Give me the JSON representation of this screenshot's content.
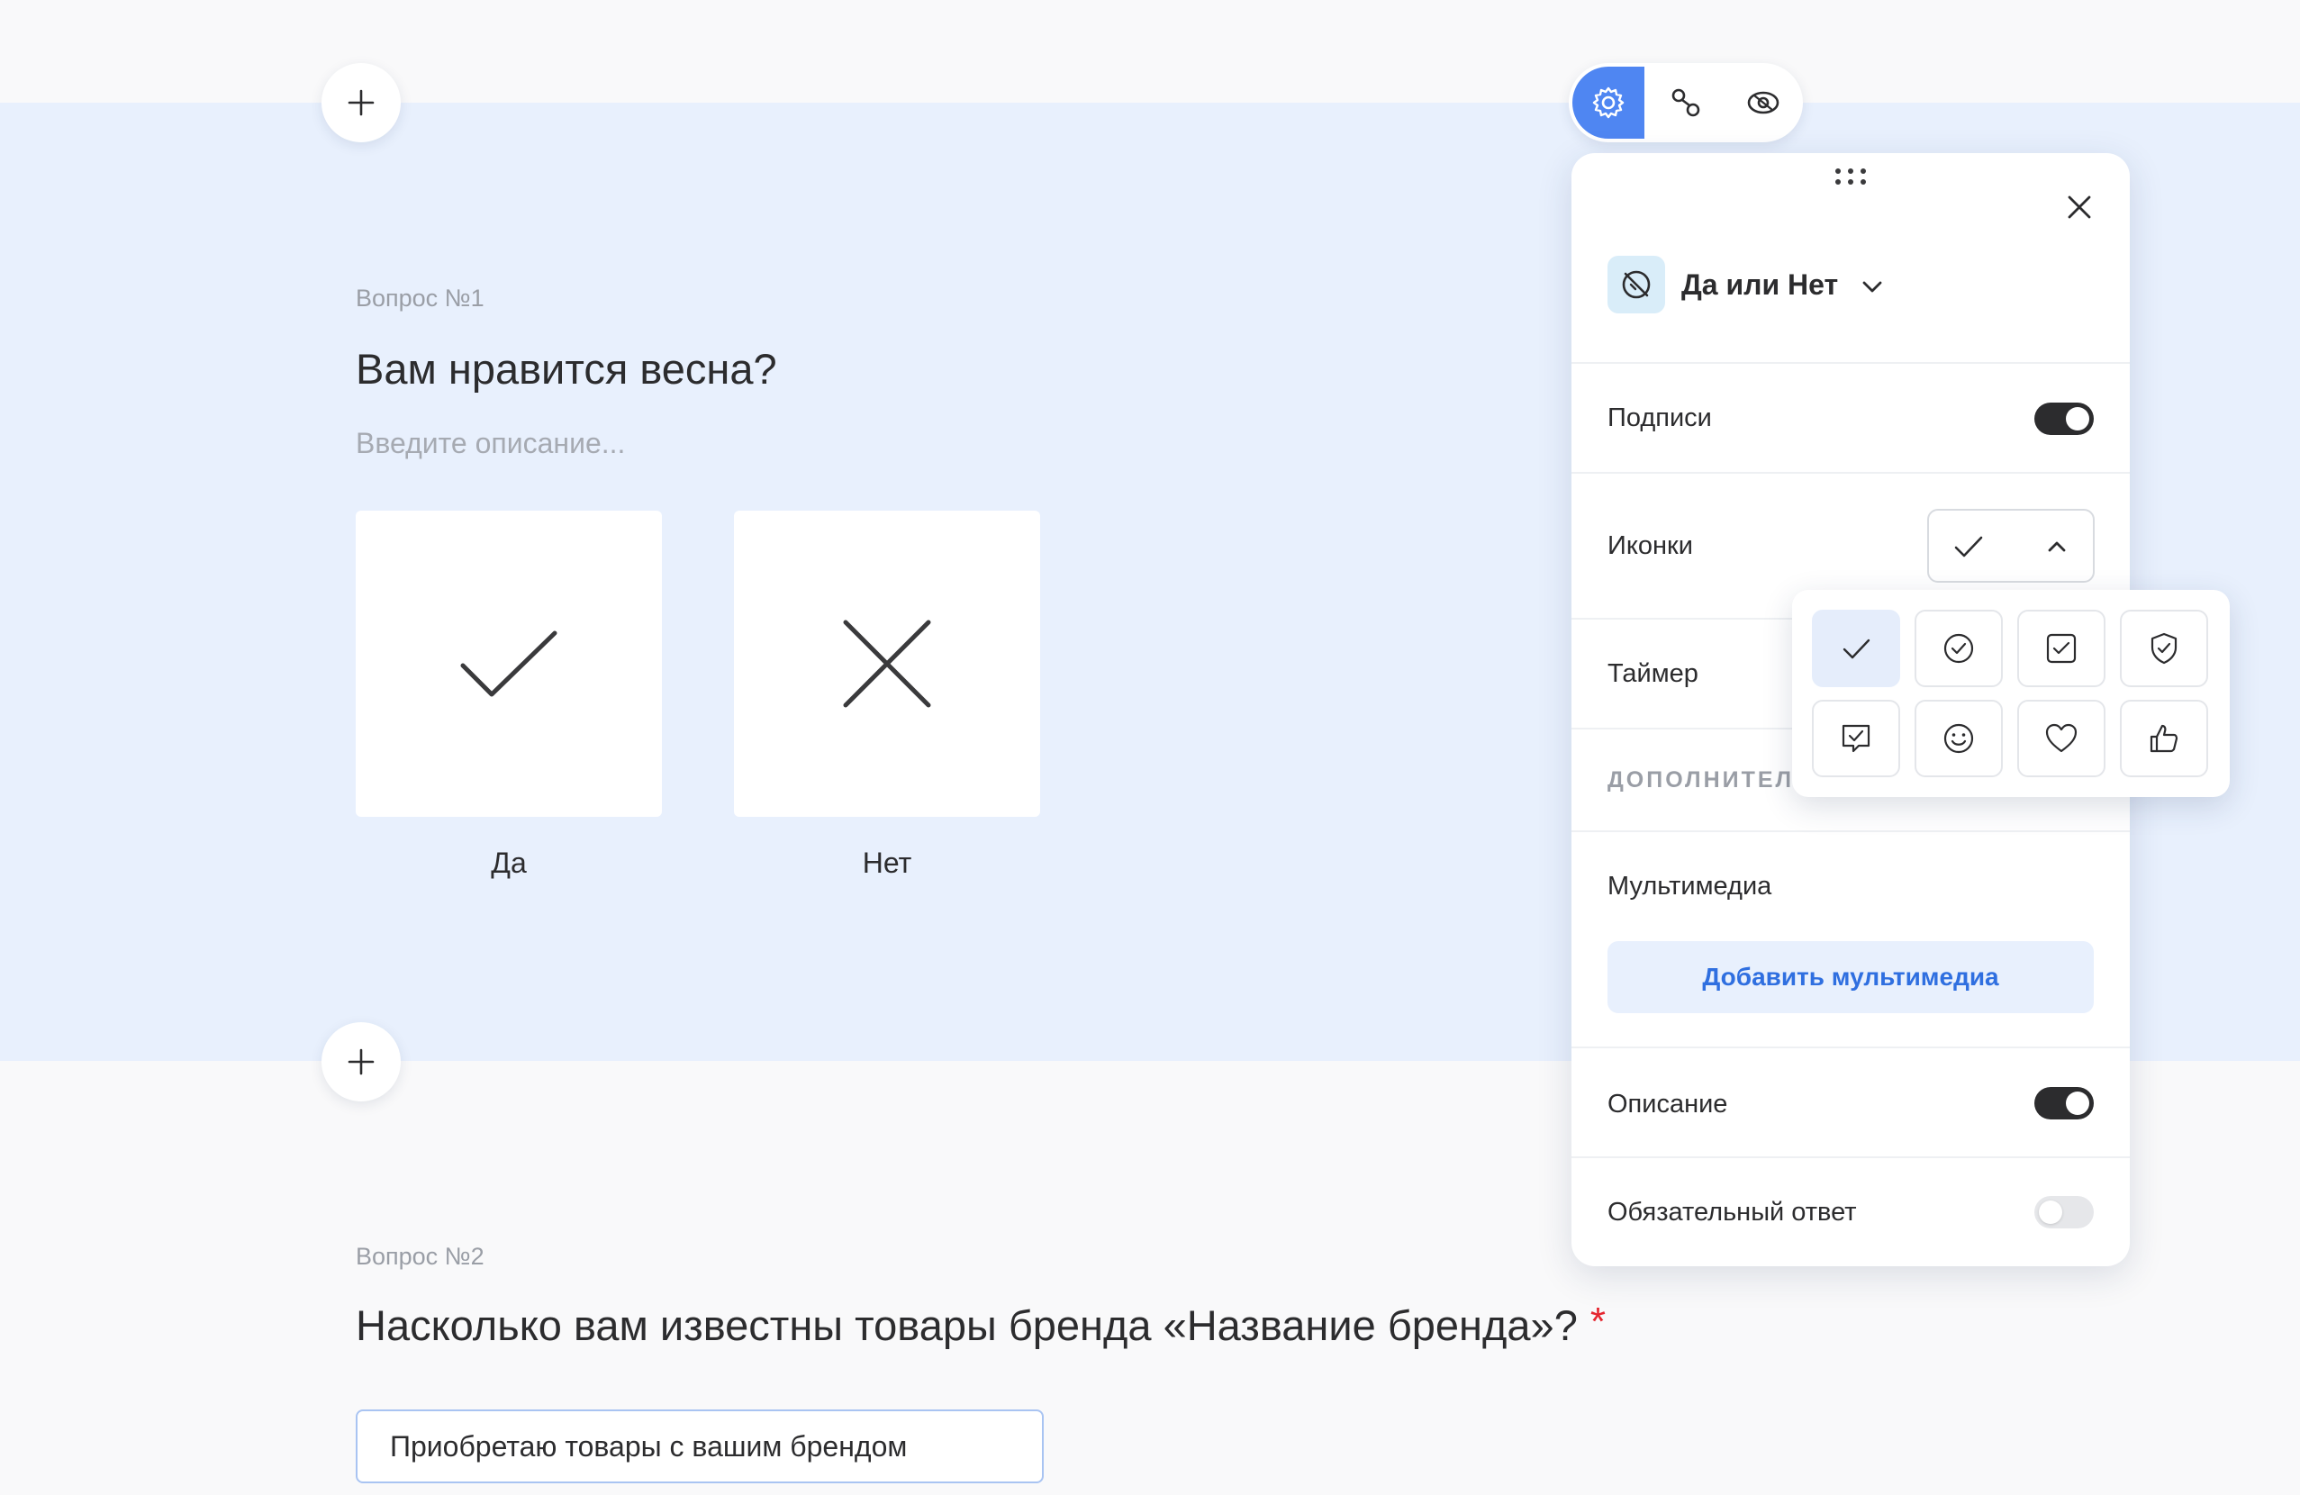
{
  "colors": {
    "accent": "#4f86f2",
    "active_band": "#e8f0fd",
    "required": "#e5262f",
    "link": "#2f6fe0"
  },
  "question1": {
    "number": "Вопрос №1",
    "title": "Вам нравится весна?",
    "description_placeholder": "Введите описание...",
    "answers": [
      {
        "label": "Да",
        "icon": "check-icon"
      },
      {
        "label": "Нет",
        "icon": "cross-icon"
      }
    ]
  },
  "question2": {
    "number": "Вопрос №2",
    "title": "Насколько вам известны товары бренда «Название бренда»?",
    "required_mark": "*",
    "first_option": "Приобретаю товары с вашим брендом"
  },
  "toolbar": {
    "items": [
      "settings-icon",
      "logic-icon",
      "preview-icon"
    ],
    "active": "settings-icon"
  },
  "panel": {
    "question_type": "Да или Нет",
    "type_icon": "yes-no-type-icon",
    "captions_label": "Подписи",
    "captions_on": true,
    "icons_label": "Иконки",
    "icons_selected": "check-icon",
    "timer_label": "Таймер",
    "extra_section": "ДОПОЛНИТЕЛЬ",
    "media_label": "Мультимедиа",
    "media_button": "Добавить мультимедиа",
    "description_label": "Описание",
    "description_on": true,
    "required_label": "Обязательный ответ",
    "required_on": false
  },
  "icon_picker": {
    "options": [
      "check-icon",
      "check-circle-icon",
      "check-square-icon",
      "check-shield-icon",
      "check-message-icon",
      "smile-icon",
      "heart-icon",
      "thumbs-up-icon"
    ],
    "selected_index": 0
  }
}
